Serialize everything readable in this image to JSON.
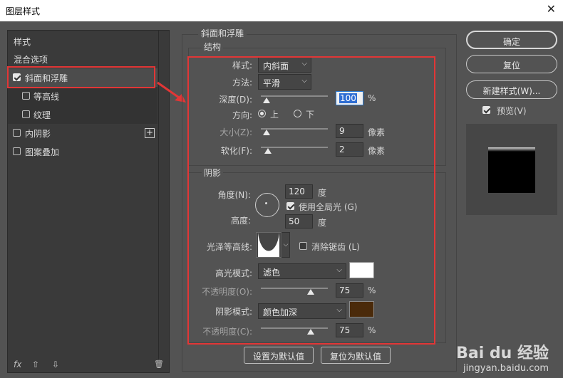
{
  "dialog": {
    "title": "图层样式",
    "close_glyph": "✕"
  },
  "left_panel": {
    "items": [
      {
        "label": "样式"
      },
      {
        "label": "混合选项"
      },
      {
        "label": "斜面和浮雕",
        "checked": true
      },
      {
        "label": "等高线",
        "checked": false
      },
      {
        "label": "纹理",
        "checked": false
      },
      {
        "label": "内阴影",
        "checked": false,
        "add": "+"
      },
      {
        "label": "图案叠加",
        "checked": false
      }
    ],
    "bottom": {
      "fx": "fx",
      "up": "⇧",
      "down": "⇩",
      "trash": "🗑"
    }
  },
  "main": {
    "section_title": "斜面和浮雕",
    "structure": {
      "title": "结构",
      "style_label": "样式:",
      "style_value": "内斜面",
      "technique_label": "方法:",
      "technique_value": "平滑",
      "depth_label": "深度(D):",
      "depth_value": "100",
      "depth_unit": "%",
      "depth_fraction": 0.1,
      "direction_label": "方向:",
      "direction_up": "上",
      "direction_down": "下",
      "size_label": "大小(Z):",
      "size_value": "9",
      "size_unit": "像素",
      "soften_label": "软化(F):",
      "soften_value": "2",
      "soften_unit": "像素"
    },
    "shading": {
      "title": "阴影",
      "angle_label": "角度(N):",
      "angle_value": "120",
      "angle_unit": "度",
      "global_light_label": "使用全局光 (G)",
      "altitude_label": "高度:",
      "altitude_value": "50",
      "altitude_unit": "度",
      "gloss_contour_label": "光泽等高线:",
      "anti_alias_label": "消除锯齿 (L)",
      "highlight_mode_label": "高光模式:",
      "highlight_mode_value": "滤色",
      "highlight_color": "#ffffff",
      "highlight_opacity_label": "不透明度(O):",
      "highlight_opacity_value": "75",
      "highlight_opacity_unit": "%",
      "shadow_mode_label": "阴影模式:",
      "shadow_mode_value": "颜色加深",
      "shadow_color": "#4a2a0a",
      "shadow_opacity_label": "不透明度(C):",
      "shadow_opacity_value": "75",
      "shadow_opacity_unit": "%"
    },
    "make_default": "设置为默认值",
    "reset_default": "复位为默认值"
  },
  "right": {
    "ok": "确定",
    "reset": "复位",
    "new_style": "新建样式(W)...",
    "preview_label": "预览(V)"
  },
  "watermark": {
    "logo": "Bai du 经验",
    "url": "jingyan.baidu.com"
  },
  "colors": {
    "annotation_red": "#e23636",
    "accent_blue": "#2e6dd2"
  }
}
